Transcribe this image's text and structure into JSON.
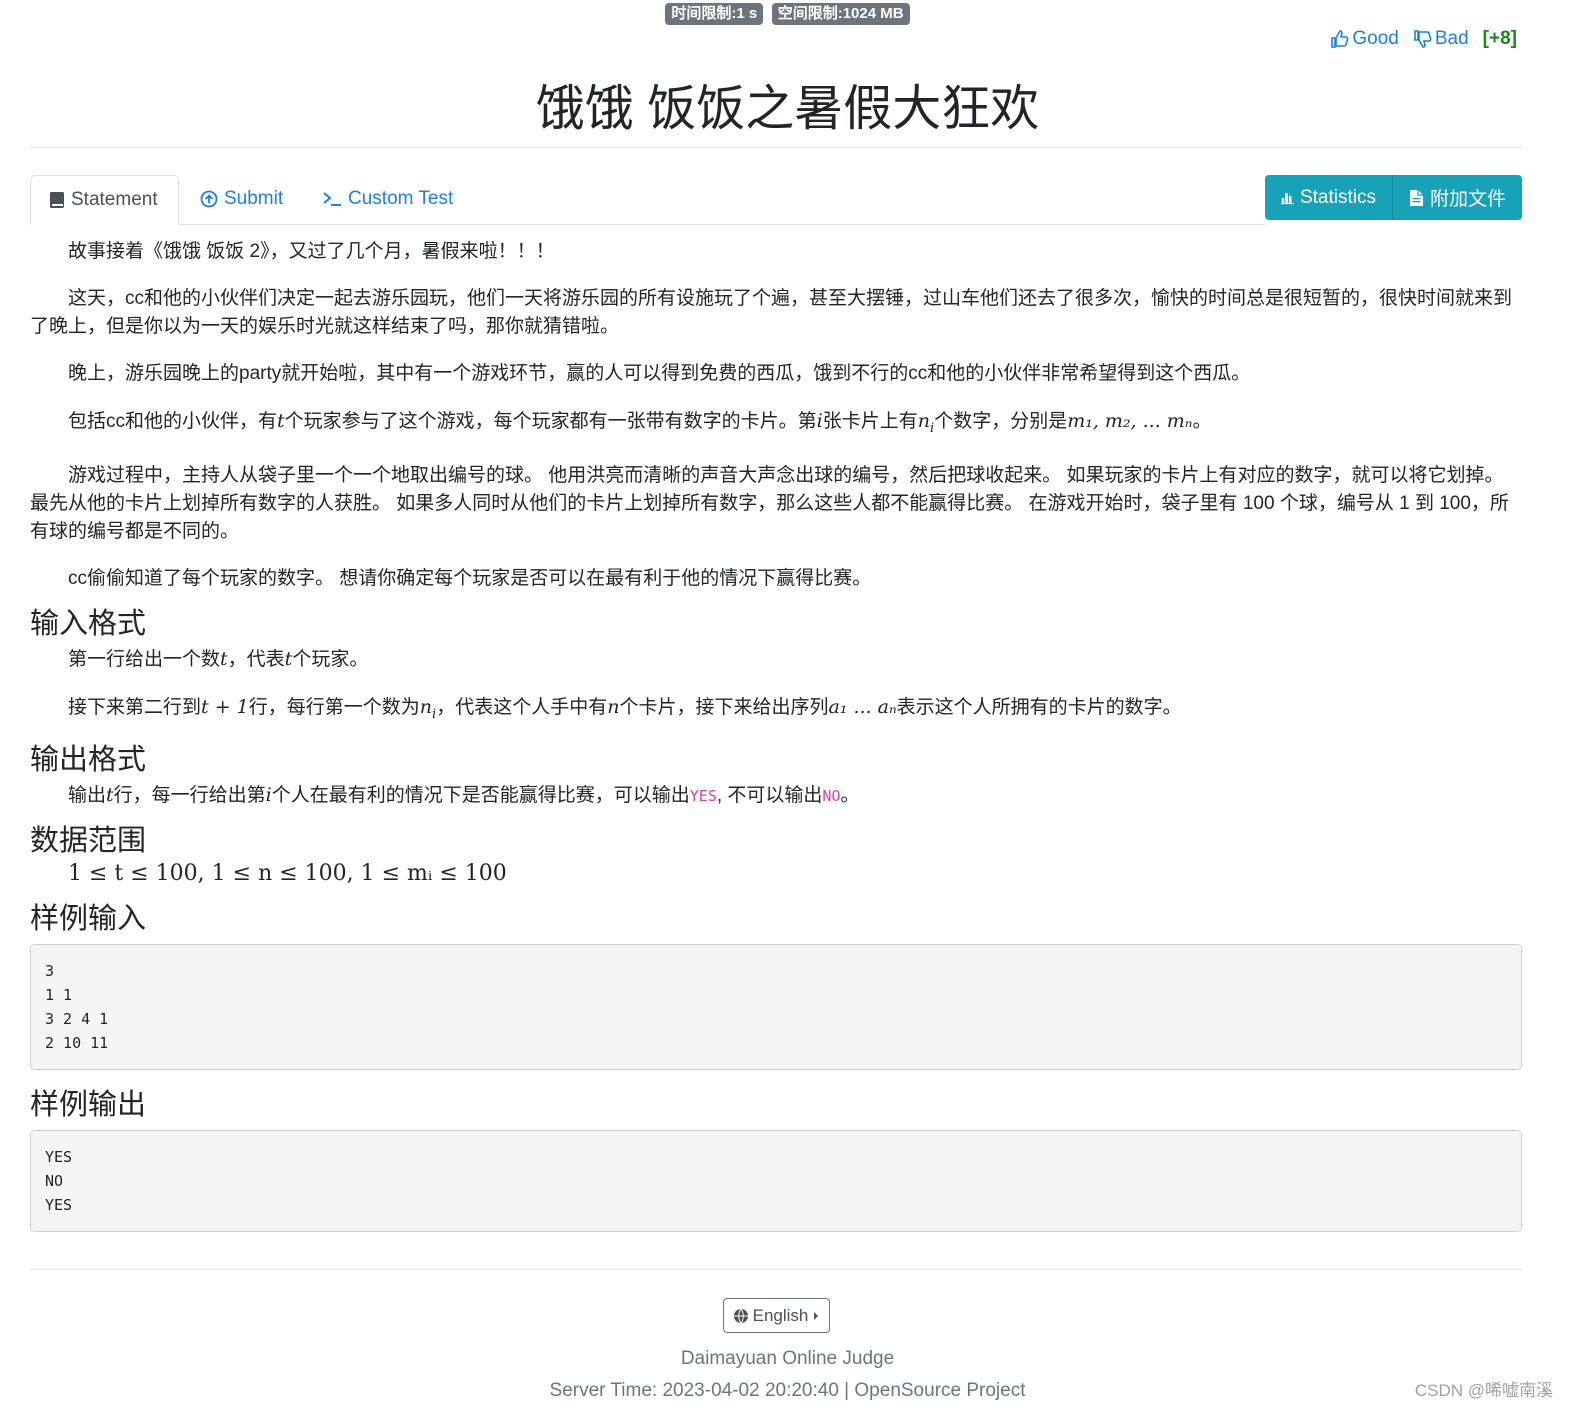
{
  "limits": {
    "time": "时间限制:1 s",
    "memory": "空间限制:1024 MB"
  },
  "rating": {
    "good": "Good",
    "bad": "Bad",
    "score": "[+8]"
  },
  "title": "饿饿 饭饭之暑假大狂欢",
  "tabs": [
    {
      "label": "Statement",
      "icon": "book-icon"
    },
    {
      "label": "Submit",
      "icon": "upload-circle-icon"
    },
    {
      "label": "Custom Test",
      "icon": "terminal-icon"
    }
  ],
  "actions": {
    "statistics": "Statistics",
    "attachments": "附加文件"
  },
  "statement": {
    "p1": "故事接着《饿饿 饭饭 2》，又过了几个月，暑假来啦！！！",
    "p2": "这天，cc和他的小伙伴们决定一起去游乐园玩，他们一天将游乐园的所有设施玩了个遍，甚至大摆锤，过山车他们还去了很多次，愉快的时间总是很短暂的，很快时间就来到了晚上，但是你以为一天的娱乐时光就这样结束了吗，那你就猜错啦。",
    "p3": "晚上，游乐园晚上的party就开始啦，其中有一个游戏环节，赢的人可以得到免费的西瓜，饿到不行的cc和他的小伙伴非常希望得到这个西瓜。",
    "p4_a": "包括cc和他的小伙伴，有",
    "p4_t": "t",
    "p4_b": "个玩家参与了这个游戏，每个玩家都有一张带有数字的卡片。第",
    "p4_i": "i",
    "p4_c": "张卡片上有",
    "p4_ni": "n",
    "p4_ni_sub": "i",
    "p4_d": "个数字，分别是",
    "p4_seq": "m₁, m₂, ... mₙ",
    "p4_end": "。",
    "p5": "游戏过程中，主持人从袋子里一个一个地取出编号的球。 他用洪亮而清晰的声音大声念出球的编号，然后把球收起来。 如果玩家的卡片上有对应的数字，就可以将它划掉。 最先从他的卡片上划掉所有数字的人获胜。 如果多人同时从他们的卡片上划掉所有数字，那么这些人都不能赢得比赛。 在游戏开始时，袋子里有 100 个球，编号从 1 到 100，所有球的编号都是不同的。",
    "p6": "cc偷偷知道了每个玩家的数字。 想请你确定每个玩家是否可以在最有利于他的情况下赢得比赛。"
  },
  "input_format": {
    "heading": "输入格式",
    "l1_a": "第一行给出一个数",
    "l1_t": "t",
    "l1_b": "，代表",
    "l1_t2": "t",
    "l1_c": "个玩家。",
    "l2_a": "接下来第二行到",
    "l2_expr": "t + 1",
    "l2_b": "行，每行第一个数为",
    "l2_n": "n",
    "l2_nsub": "i",
    "l2_c": "，代表这个人手中有",
    "l2_n2": "n",
    "l2_d": "个卡片，接下来给出序列",
    "l2_seq": "a₁ ... aₙ",
    "l2_e": "表示这个人所拥有的卡片的数字。"
  },
  "output_format": {
    "heading": "输出格式",
    "a": "输出",
    "t": "t",
    "b": "行，每一行给出第",
    "i": "i",
    "c": "个人在最有利的情况下是否能赢得比赛，可以输出",
    "yes": "YES",
    "d": ", 不可以输出",
    "no": "NO",
    "e": "。"
  },
  "constraints": {
    "heading": "数据范围",
    "expr": "1 ≤ t ≤ 100, 1 ≤ n ≤ 100, 1 ≤ mᵢ ≤ 100"
  },
  "sample_input": {
    "heading": "样例输入",
    "lines": [
      "3",
      "1 1",
      "3 2 4 1",
      "2 10 11"
    ]
  },
  "sample_output": {
    "heading": "样例输出",
    "lines": [
      "YES",
      "NO",
      "YES"
    ]
  },
  "footer": {
    "language": "English",
    "site": "Daimayuan Online Judge",
    "server_time": "Server Time: 2023-04-02 20:20:40",
    "separator": " | ",
    "project": "OpenSource Project"
  },
  "watermark": "CSDN @唏嘘南溪",
  "colors": {
    "link": "#1d7fe0",
    "info": "#17a2b8",
    "badge": "#6c757d",
    "score": "#1a8a1a",
    "code": "#e83e8c"
  }
}
